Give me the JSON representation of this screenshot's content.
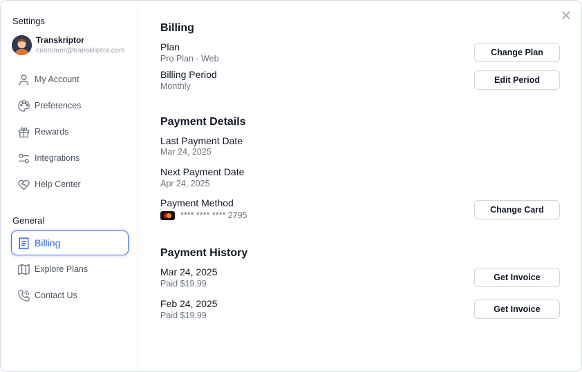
{
  "sidebar": {
    "settings_heading": "Settings",
    "profile": {
      "name": "Transkriptor",
      "email": "customer@transkriptor.com"
    },
    "account_items": [
      {
        "label": "My Account",
        "icon": "user-icon"
      },
      {
        "label": "Preferences",
        "icon": "palette-icon"
      },
      {
        "label": "Rewards",
        "icon": "gift-icon"
      },
      {
        "label": "Integrations",
        "icon": "sliders-icon"
      },
      {
        "label": "Help Center",
        "icon": "heart-handshake-icon"
      }
    ],
    "general_heading": "General",
    "general_items": [
      {
        "label": "Billing",
        "icon": "receipt-icon",
        "active": true
      },
      {
        "label": "Explore Plans",
        "icon": "map-icon"
      },
      {
        "label": "Contact Us",
        "icon": "phone-icon"
      }
    ]
  },
  "billing": {
    "title": "Billing",
    "plan_label": "Plan",
    "plan_value": "Pro Plan - Web",
    "change_plan_button": "Change Plan",
    "period_label": "Billing Period",
    "period_value": "Monthly",
    "edit_period_button": "Edit Period"
  },
  "payment_details": {
    "title": "Payment Details",
    "last_payment_label": "Last Payment Date",
    "last_payment_value": "Mar 24, 2025",
    "next_payment_label": "Next Payment Date",
    "next_payment_value": "Apr 24, 2025",
    "method_label": "Payment Method",
    "card_number": "**** **** **** 2795",
    "change_card_button": "Change Card"
  },
  "payment_history": {
    "title": "Payment History",
    "entries": [
      {
        "date": "Mar 24, 2025",
        "status": "Paid $19.99",
        "button": "Get Invoice"
      },
      {
        "date": "Feb 24, 2025",
        "status": "Paid $19.99",
        "button": "Get Invoice"
      }
    ]
  },
  "colors": {
    "accent": "#2f63dd",
    "muted_text": "#6b7280",
    "border": "#d1d5db"
  }
}
